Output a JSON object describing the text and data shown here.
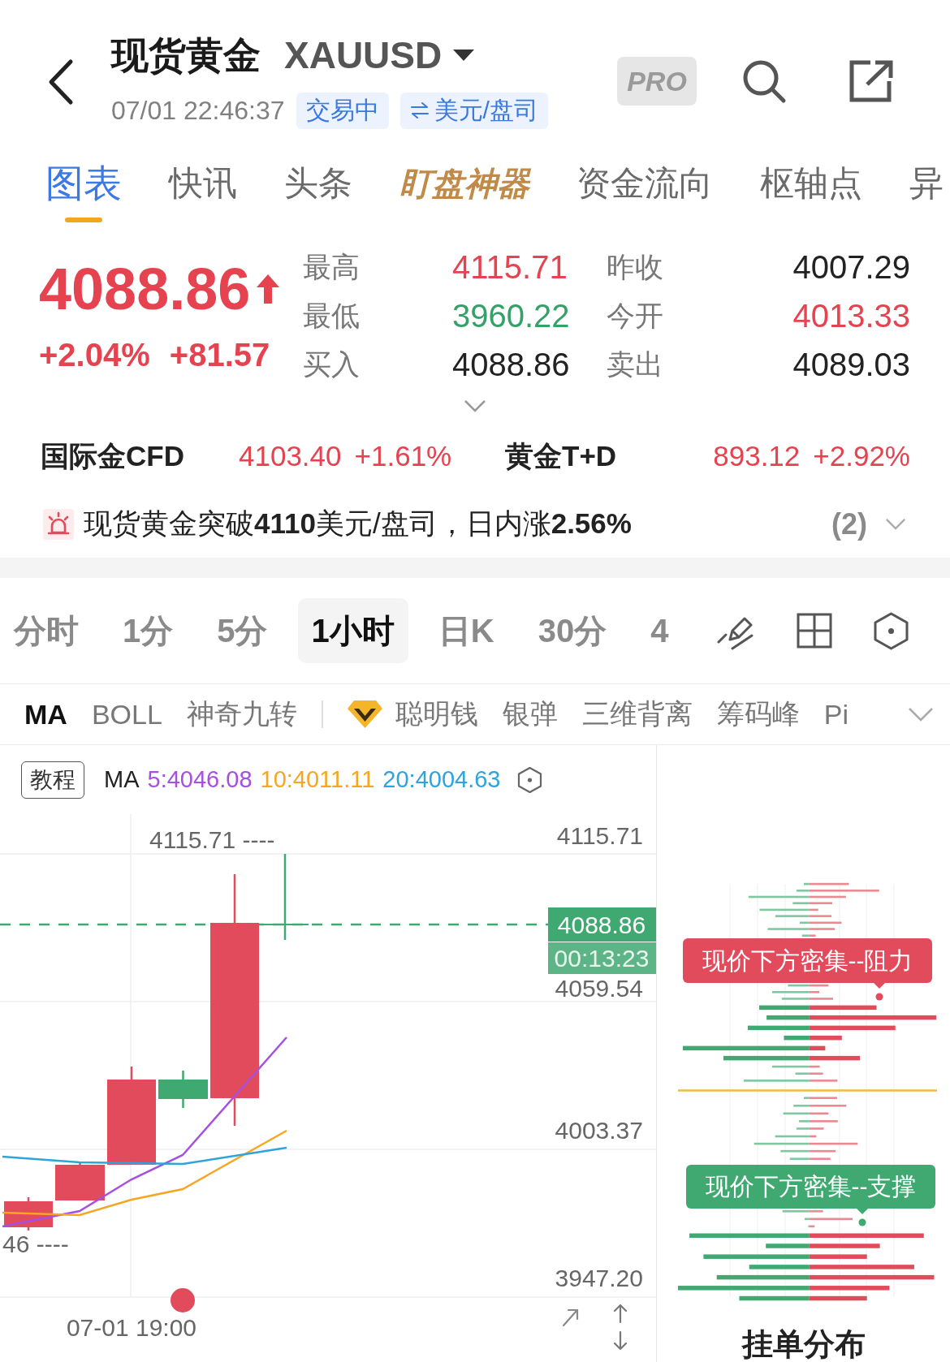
{
  "header": {
    "title": "现货黄金",
    "symbol": "XAUUSD",
    "time": "07/01 22:46:37",
    "badges": [
      {
        "kind": "status",
        "label": "交易中"
      },
      {
        "kind": "unit",
        "label": "美元/盘司"
      }
    ],
    "pro_label": "PRO"
  },
  "tabs": [
    {
      "label": "图表",
      "kind": "plain",
      "selected": true
    },
    {
      "label": "快讯",
      "kind": "plain",
      "selected": false
    },
    {
      "label": "头条",
      "kind": "plain",
      "selected": false
    },
    {
      "label": "盯盘神器",
      "kind": "premium",
      "selected": false
    },
    {
      "label": "资金流向",
      "kind": "plain",
      "selected": false
    },
    {
      "label": "枢轴点",
      "kind": "plain",
      "selected": false
    },
    {
      "label": "异",
      "kind": "plain",
      "selected": false
    }
  ],
  "quote": {
    "price": "4088.86",
    "rising": true,
    "change_percent": "+2.04%",
    "change": "+81.57",
    "stats": [
      {
        "label": "最高",
        "value": "4115.71",
        "color": "#e4434f"
      },
      {
        "label": "昨收",
        "value": "4007.29",
        "color": "#222222"
      },
      {
        "label": "最低",
        "value": "3960.22",
        "color": "#35a168"
      },
      {
        "label": "今开",
        "value": "4013.33",
        "color": "#e4434f"
      },
      {
        "label": "买入",
        "value": "4088.86",
        "color": "#222222"
      },
      {
        "label": "卖出",
        "value": "4089.03",
        "color": "#222222"
      }
    ]
  },
  "related": [
    {
      "name": "国际金CFD",
      "price": "4103.40",
      "change": "+1.61%",
      "color": "#e4434f"
    },
    {
      "name": "黄金T+D",
      "price": "893.12",
      "change": "+2.92%",
      "color": "#e4434f"
    }
  ],
  "alert": {
    "text": "现货黄金突破**4110**美元/盘司，日内涨**2.56%**",
    "count": "(2)"
  },
  "periods": [
    {
      "label": "分时",
      "selected": false
    },
    {
      "label": "1分",
      "selected": false
    },
    {
      "label": "5分",
      "selected": false
    },
    {
      "label": "1小时",
      "selected": true
    },
    {
      "label": "日K",
      "selected": false
    },
    {
      "label": "30分",
      "selected": false
    },
    {
      "label": "4",
      "selected": false
    }
  ],
  "indicators": [
    {
      "label": "MA",
      "kind": "plain",
      "selected": true
    },
    {
      "label": "BOLL",
      "kind": "plain",
      "selected": false
    },
    {
      "label": "神奇九转",
      "kind": "plain",
      "selected": false
    },
    {
      "label": "聪明钱",
      "kind": "premium",
      "selected": false
    },
    {
      "label": "银弹",
      "kind": "plain",
      "selected": false
    },
    {
      "label": "三维背离",
      "kind": "plain",
      "selected": false
    },
    {
      "label": "筹码峰",
      "kind": "plain",
      "selected": false
    },
    {
      "label": "Pi",
      "kind": "plain",
      "selected": false
    }
  ],
  "chart": {
    "tutorial": "教程",
    "ma_label": "MA",
    "ma_values": [
      {
        "text": "5:4046.08",
        "color": "#a64fe0"
      },
      {
        "text": "10:4011.11",
        "color": "#f5a623"
      },
      {
        "text": "20:4004.63",
        "color": "#2ea3dc"
      }
    ],
    "high_label": "4115.71 ----",
    "low_label": "46 ----",
    "y_labels": [
      "4115.71",
      "4059.54",
      "4003.37",
      "3947.20"
    ],
    "last_price": "4088.86",
    "countdown": "00:13:23",
    "x_label": "07-01 19:00"
  },
  "order_book": {
    "callouts": [
      {
        "kind": "resistance",
        "text": "现价下方密集--阻力"
      },
      {
        "kind": "support",
        "text": "现价下方密集--支撑"
      }
    ],
    "title": "挂单分布"
  }
}
